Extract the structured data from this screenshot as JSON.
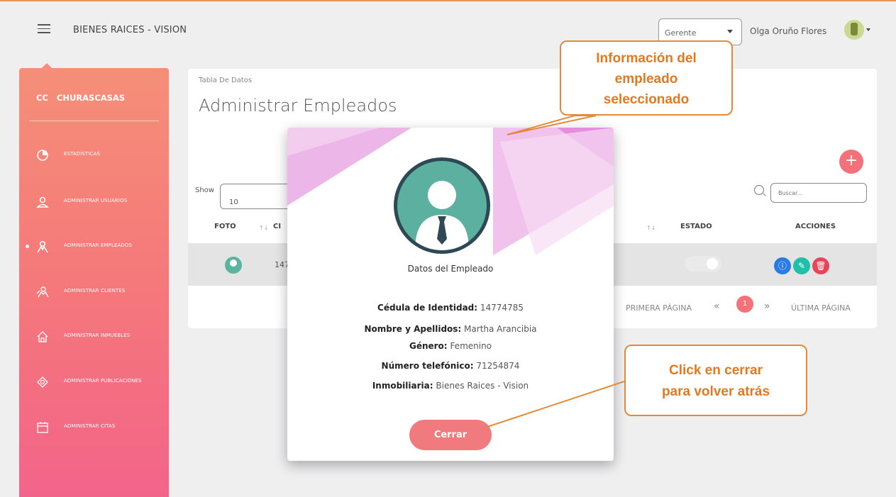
{
  "header": {
    "brand": "BIENES RAICES - VISION",
    "role_value": "Gerente",
    "user_name": "Olga Oruño Flores"
  },
  "sidebar": {
    "brand_abbrev": "CC",
    "brand_name": "CHURASCASAS",
    "items": [
      {
        "label": "ESTADÍSTICAS",
        "icon": "chart-pie-icon"
      },
      {
        "label": "ADMINISTRAR USUARIOS",
        "icon": "user-icon"
      },
      {
        "label": "ADMINISTRAR EMPLEADOS",
        "icon": "employee-icon",
        "active": true
      },
      {
        "label": "ADMINISTRAR CLIENTES",
        "icon": "clients-icon"
      },
      {
        "label": "ADMINISTRAR INMUEBLES",
        "icon": "house-icon"
      },
      {
        "label": "ADMINISTRAR PUBLICACIONES",
        "icon": "tag-icon"
      },
      {
        "label": "ADMINISTRAR CITAS",
        "icon": "calendar-icon"
      }
    ]
  },
  "main": {
    "breadcrumb": "Tabla De Datos",
    "title": "Administrar Empleados",
    "show_label": "Show",
    "show_value": "10",
    "search_placeholder": "Buscar...",
    "columns": {
      "foto": "FOTO",
      "ci": "CI",
      "estado": "ESTADO",
      "acciones": "ACCIONES"
    },
    "row": {
      "ci": "147"
    },
    "pagination": {
      "first": "PRIMERA PÁGINA",
      "current": "1",
      "last": "ÚLTIMA PÁGINA"
    }
  },
  "modal": {
    "title": "Datos del Empleado",
    "fields": [
      {
        "label": "Cédula de Identidad:",
        "value": "14774785"
      },
      {
        "label": "Nombre y Apellidos:",
        "value": "Martha Arancibia"
      },
      {
        "label": "Género:",
        "value": "Femenino"
      },
      {
        "label": "Número telefónico:",
        "value": "71254874"
      },
      {
        "label": "Inmobiliaria:",
        "value": "Bienes Raices - Vision"
      }
    ],
    "close_label": "Cerrar"
  },
  "annotations": {
    "top_lines": [
      "Información del",
      "empleado",
      "seleccionado"
    ],
    "bottom_lines": [
      "Click en cerrar",
      "para volver atrás"
    ]
  },
  "colors": {
    "accent": "#f4717a",
    "callout_border": "#e38a3a",
    "callout_text": "#e07a20"
  }
}
